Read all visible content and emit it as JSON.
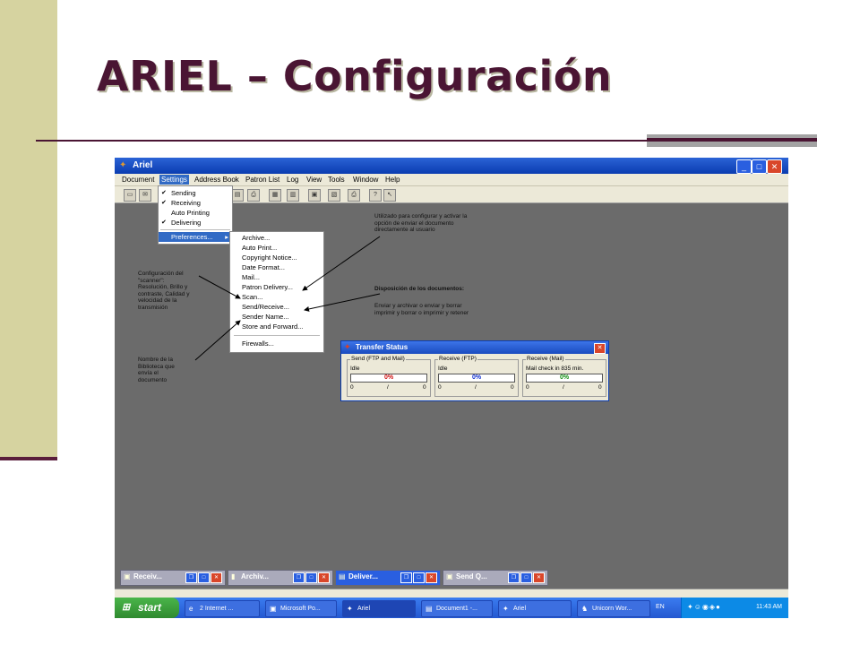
{
  "slide": {
    "title": "ARIEL – Configuración"
  },
  "window": {
    "title": "Ariel",
    "controls": [
      "_",
      "□",
      "✕"
    ]
  },
  "menubar": {
    "items": [
      "Document",
      "Settings",
      "Address Book",
      "Patron List",
      "Log",
      "View",
      "Tools",
      "Window",
      "Help"
    ],
    "active": "Settings"
  },
  "settings_menu": {
    "items": [
      {
        "label": "Sending",
        "checked": true
      },
      {
        "label": "Receiving",
        "checked": true
      },
      {
        "label": "Auto Printing",
        "checked": false
      },
      {
        "label": "Delivering",
        "checked": true
      },
      {
        "label": "Preferences...",
        "submenu": true
      }
    ]
  },
  "preferences_submenu": {
    "items": [
      "Archive...",
      "Auto Print...",
      "Copyright Notice...",
      "Date Format...",
      "Mail...",
      "Patron Delivery...",
      "Scan...",
      "Send/Receive...",
      "Sender Name...",
      "Store and Forward...",
      "Firewalls..."
    ]
  },
  "notes": {
    "delivery_line1": "Utilizado para configurar y activar la",
    "delivery_line2": "opción de enviar el documento",
    "delivery_line3": "directamente  al usuario",
    "scanner_line1": "Configuración  del",
    "scanner_line2": "\"scanner\":",
    "scanner_line3": "Resolución,  Brillo y",
    "scanner_line4": "contraste,   Calidad  y",
    "scanner_line5": "velocidad  de  la",
    "scanner_line6": "transmisión",
    "disposition_title": "Disposición de los documentos:",
    "disposition_line1": "Enviar y archivar o enviar y borrar",
    "disposition_line2": "imprimir y borrar o imprimir y retener",
    "sender_line1": "Nombre de la",
    "sender_line2": "Biblioteca  que",
    "sender_line3": "envía  el",
    "sender_line4": "documento"
  },
  "transfer_status": {
    "title": "Transfer Status",
    "groups": [
      {
        "header": "Send (FTP and Mail)",
        "status": "Idle",
        "percent": "0%",
        "color": "#d01010",
        "left": "0",
        "sep": "/",
        "right": "0"
      },
      {
        "header": "Receive (FTP)",
        "status": "Idle",
        "percent": "0%",
        "color": "#1030d0",
        "left": "0",
        "sep": "/",
        "right": "0"
      },
      {
        "header": "Receive (Mail)",
        "status": "Mail check in 835 min.",
        "percent": "0%",
        "color": "#109010",
        "left": "0",
        "sep": "/",
        "right": "0"
      }
    ]
  },
  "mdi_windows": [
    {
      "label": "Receiv..."
    },
    {
      "label": "Archiv..."
    },
    {
      "label": "Deliver..."
    },
    {
      "label": "Send Q..."
    }
  ],
  "taskbar": {
    "start": "start",
    "buttons": [
      {
        "label": "2 Internet ..."
      },
      {
        "label": "Microsoft Po..."
      },
      {
        "label": "Ariel"
      },
      {
        "label": "Document1 -..."
      },
      {
        "label": "Ariel"
      },
      {
        "label": "Unicorn Wor..."
      }
    ],
    "lang": "EN",
    "clock": "11:43 AM"
  }
}
